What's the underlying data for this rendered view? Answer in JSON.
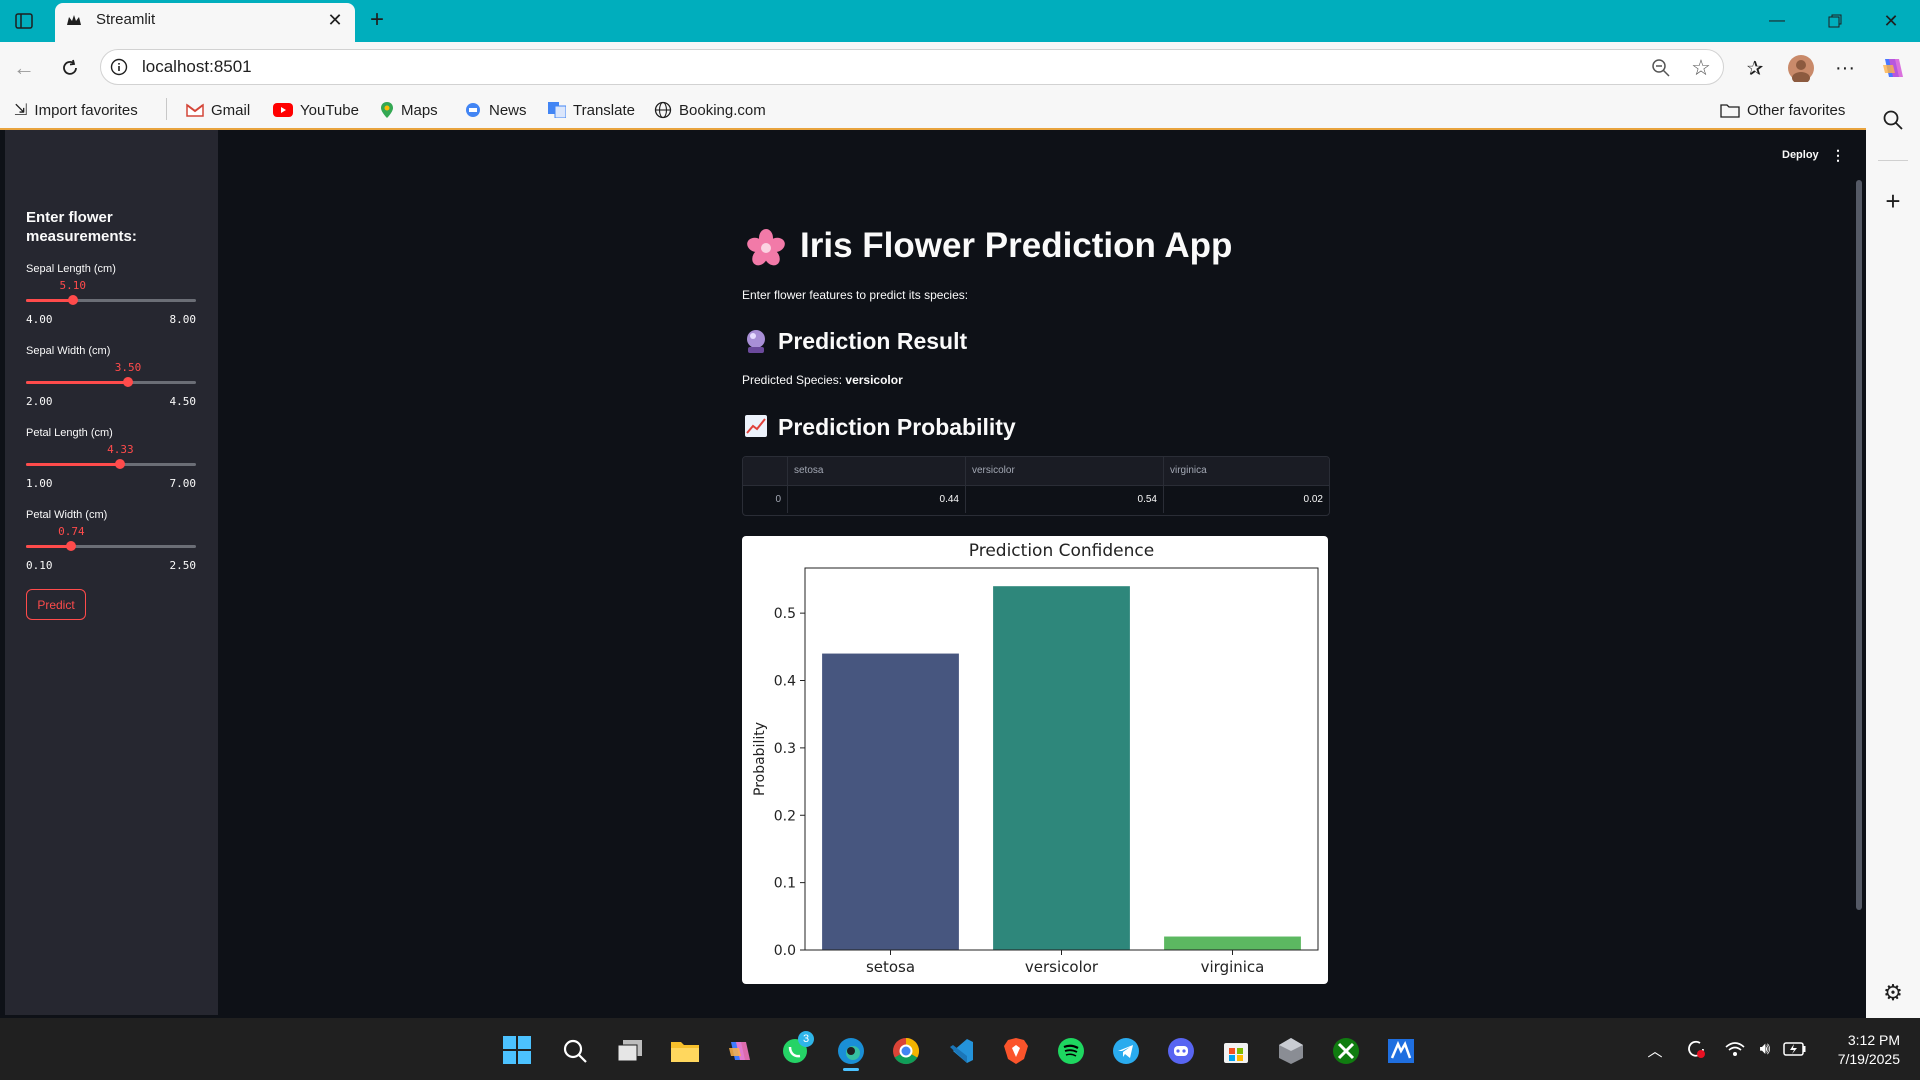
{
  "browser": {
    "tab_title": "Streamlit",
    "url": "localhost:8501",
    "favorites": [
      "Import favorites",
      "Gmail",
      "YouTube",
      "Maps",
      "News",
      "Translate",
      "Booking.com"
    ],
    "other_favorites": "Other favorites"
  },
  "app": {
    "deploy_label": "Deploy",
    "sidebar": {
      "heading": "Enter flower measurements:",
      "sliders": [
        {
          "label": "Sepal Length (cm)",
          "value": "5.10",
          "min": "4.00",
          "max": "8.00",
          "fraction": 0.275
        },
        {
          "label": "Sepal Width (cm)",
          "value": "3.50",
          "min": "2.00",
          "max": "4.50",
          "fraction": 0.6
        },
        {
          "label": "Petal Length (cm)",
          "value": "4.33",
          "min": "1.00",
          "max": "7.00",
          "fraction": 0.555
        },
        {
          "label": "Petal Width (cm)",
          "value": "0.74",
          "min": "0.10",
          "max": "2.50",
          "fraction": 0.267
        }
      ],
      "predict_label": "Predict"
    },
    "title": "Iris Flower Prediction App",
    "subtitle": "Enter flower features to predict its species:",
    "result_heading": "Prediction Result",
    "predicted_label": "Predicted Species:",
    "predicted_value": "versicolor",
    "prob_heading": "Prediction Probability",
    "table": {
      "columns": [
        "",
        "setosa",
        "versicolor",
        "virginica"
      ],
      "rows": [
        [
          "0",
          "0.44",
          "0.54",
          "0.02"
        ]
      ]
    }
  },
  "chart_data": {
    "type": "bar",
    "title": "Prediction Confidence",
    "xlabel": "",
    "ylabel": "Probability",
    "categories": [
      "setosa",
      "versicolor",
      "virginica"
    ],
    "values": [
      0.44,
      0.54,
      0.02
    ],
    "colors": [
      "#47567f",
      "#2e877b",
      "#5cb861"
    ],
    "ylim": [
      0,
      0.567
    ],
    "yticks": [
      "0.0",
      "0.1",
      "0.2",
      "0.3",
      "0.4",
      "0.5"
    ]
  },
  "taskbar": {
    "time": "3:12 PM",
    "date": "7/19/2025",
    "whatsapp_badge": "3"
  }
}
